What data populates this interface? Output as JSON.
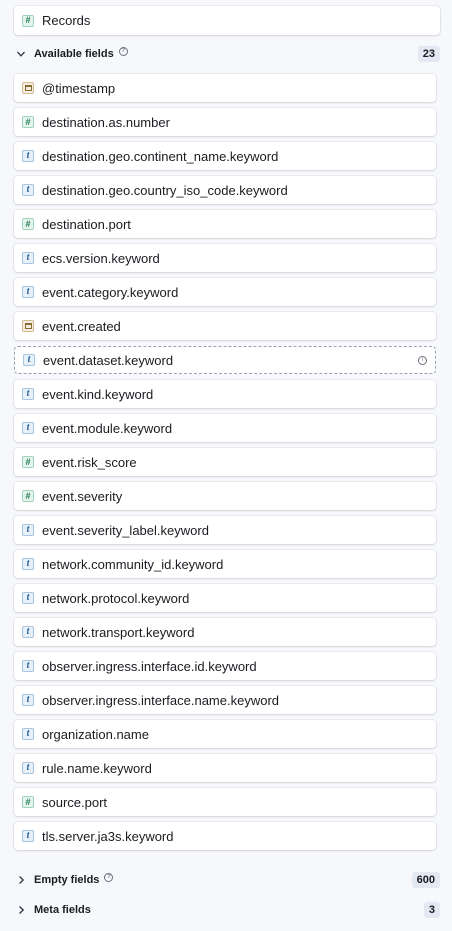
{
  "records": {
    "label": "Records",
    "type": "number"
  },
  "available": {
    "label": "Available fields",
    "count": "23"
  },
  "fields": [
    {
      "name": "@timestamp",
      "type": "date"
    },
    {
      "name": "destination.as.number",
      "type": "number"
    },
    {
      "name": "destination.geo.continent_name.keyword",
      "type": "string"
    },
    {
      "name": "destination.geo.country_iso_code.keyword",
      "type": "string"
    },
    {
      "name": "destination.port",
      "type": "number"
    },
    {
      "name": "ecs.version.keyword",
      "type": "string"
    },
    {
      "name": "event.category.keyword",
      "type": "string"
    },
    {
      "name": "event.created",
      "type": "date"
    },
    {
      "name": "event.dataset.keyword",
      "type": "string",
      "dragging": true
    },
    {
      "name": "event.kind.keyword",
      "type": "string"
    },
    {
      "name": "event.module.keyword",
      "type": "string"
    },
    {
      "name": "event.risk_score",
      "type": "number"
    },
    {
      "name": "event.severity",
      "type": "number"
    },
    {
      "name": "event.severity_label.keyword",
      "type": "string"
    },
    {
      "name": "network.community_id.keyword",
      "type": "string"
    },
    {
      "name": "network.protocol.keyword",
      "type": "string"
    },
    {
      "name": "network.transport.keyword",
      "type": "string"
    },
    {
      "name": "observer.ingress.interface.id.keyword",
      "type": "string"
    },
    {
      "name": "observer.ingress.interface.name.keyword",
      "type": "string"
    },
    {
      "name": "organization.name",
      "type": "string"
    },
    {
      "name": "rule.name.keyword",
      "type": "string"
    },
    {
      "name": "source.port",
      "type": "number"
    },
    {
      "name": "tls.server.ja3s.keyword",
      "type": "string"
    }
  ],
  "empty": {
    "label": "Empty fields",
    "count": "600"
  },
  "meta": {
    "label": "Meta fields",
    "count": "3"
  }
}
